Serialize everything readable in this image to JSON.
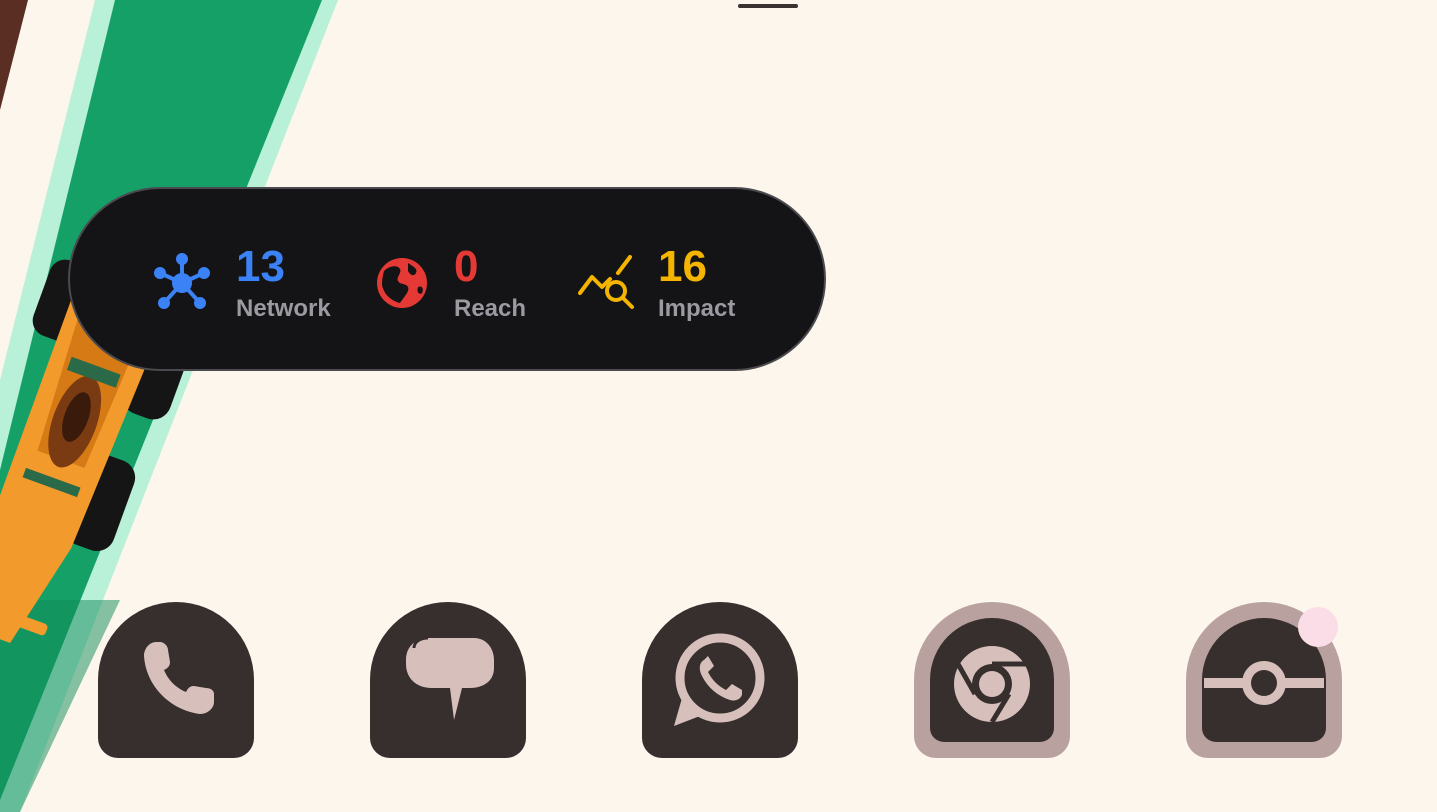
{
  "widget": {
    "stats": [
      {
        "value": "13",
        "label": "Network",
        "icon": "network-icon",
        "color": "#3b82f6"
      },
      {
        "value": "0",
        "label": "Reach",
        "icon": "globe-icon",
        "color": "#e53935"
      },
      {
        "value": "16",
        "label": "Impact",
        "icon": "trend-search-icon",
        "color": "#f5b400"
      }
    ]
  },
  "dock": {
    "apps": [
      {
        "name": "Phone",
        "icon": "phone-icon"
      },
      {
        "name": "Messages",
        "icon": "chat-bubble-icon"
      },
      {
        "name": "WhatsApp",
        "icon": "whatsapp-icon"
      },
      {
        "name": "Chrome",
        "icon": "chrome-icon"
      },
      {
        "name": "Pokeball app",
        "icon": "pokeball-icon",
        "has_notification": true
      }
    ]
  },
  "colors": {
    "background": "#fdf6ed",
    "widget_bg": "#141416",
    "icon_bg": "#362f2d",
    "icon_fg": "#d7c0bb",
    "track_green": "#16a067",
    "car_orange": "#f39a2d"
  }
}
